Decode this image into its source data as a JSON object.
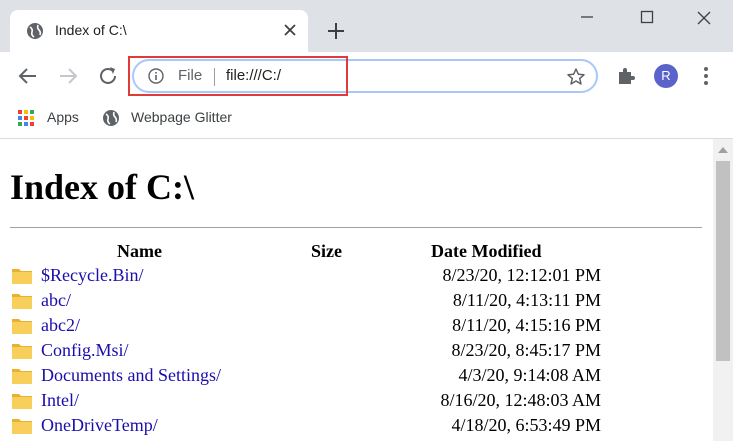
{
  "tab": {
    "title": "Index of C:\\"
  },
  "toolbar": {
    "chip": "File",
    "url": "file:///C:/",
    "avatar": "R"
  },
  "bookmarks": [
    {
      "label": "Apps",
      "icon": "apps-grid-icon"
    },
    {
      "label": "Webpage Glitter",
      "icon": "globe-icon"
    }
  ],
  "page": {
    "title": "Index of C:\\",
    "columns": {
      "name": "Name",
      "size": "Size",
      "date": "Date Modified"
    },
    "rows": [
      {
        "name": "$Recycle.Bin/",
        "size": "",
        "date": "8/23/20, 12:12:01 PM"
      },
      {
        "name": "abc/",
        "size": "",
        "date": "8/11/20, 4:13:11 PM"
      },
      {
        "name": "abc2/",
        "size": "",
        "date": "8/11/20, 4:15:16 PM"
      },
      {
        "name": "Config.Msi/",
        "size": "",
        "date": "8/23/20, 8:45:17 PM"
      },
      {
        "name": "Documents and Settings/",
        "size": "",
        "date": "4/3/20, 9:14:08 AM"
      },
      {
        "name": "Intel/",
        "size": "",
        "date": "8/16/20, 12:48:03 AM"
      },
      {
        "name": "OneDriveTemp/",
        "size": "",
        "date": "4/18/20, 6:53:49 PM"
      }
    ]
  },
  "colors": {
    "link": "#1a0dab",
    "highlight_box": "#e03b3b",
    "tabstrip": "#dee1e6",
    "folder": "#f5c542"
  }
}
